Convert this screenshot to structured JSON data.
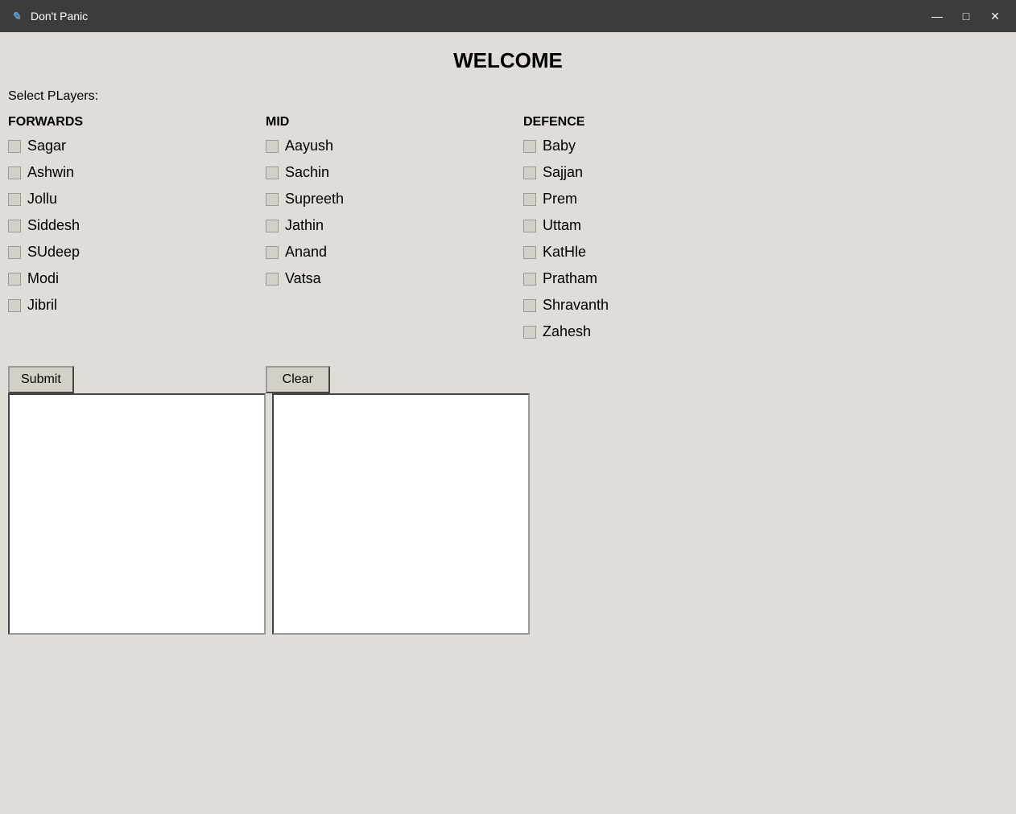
{
  "titleBar": {
    "title": "Don't Panic",
    "icon": "✎",
    "minimize": "—",
    "maximize": "□",
    "close": "✕"
  },
  "welcome": {
    "heading": "WELCOME",
    "selectLabel": "Select PLayers:"
  },
  "columns": [
    {
      "header": "FORWARDS",
      "players": [
        "Sagar",
        "Ashwin",
        "Jollu",
        "Siddesh",
        "SUdeep",
        "Modi",
        "Jibril"
      ]
    },
    {
      "header": "MID",
      "players": [
        "Aayush",
        "Sachin",
        "Supreeth",
        "Jathin",
        "Anand",
        "Vatsa"
      ]
    },
    {
      "header": "DEFENCE",
      "players": [
        "Baby",
        "Sajjan",
        "Prem",
        "Uttam",
        "KatHle",
        "Pratham",
        "Shravanth",
        "Zahesh"
      ]
    }
  ],
  "buttons": {
    "submit": "Submit",
    "clear": "Clear"
  }
}
